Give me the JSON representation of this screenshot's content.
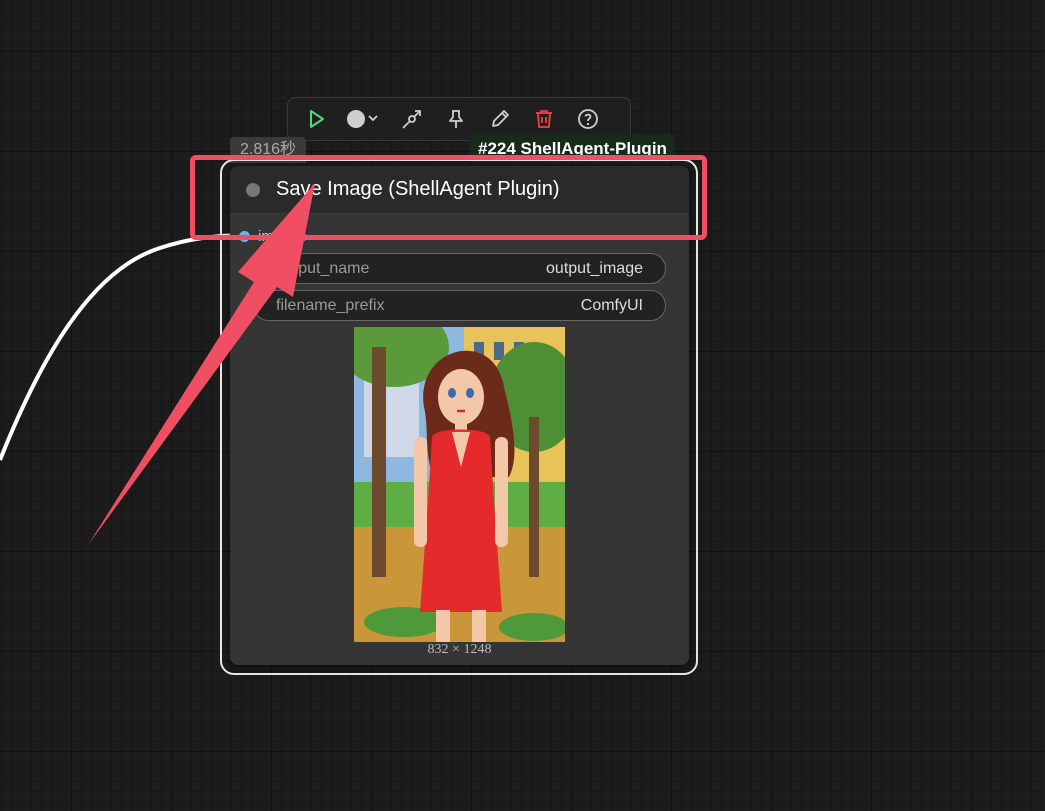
{
  "toolbar": {
    "buttons": [
      {
        "icon": "play-icon",
        "color": "#4ade80"
      },
      {
        "icon": "color-dot-dropdown-icon",
        "color": "#cfcfcf"
      },
      {
        "icon": "bypass-icon",
        "color": "#cfcfcf"
      },
      {
        "icon": "pin-icon",
        "color": "#cfcfcf"
      },
      {
        "icon": "pencil-icon",
        "color": "#cfcfcf"
      },
      {
        "icon": "trash-icon",
        "color": "#ef4444"
      },
      {
        "icon": "help-icon",
        "color": "#cfcfcf"
      }
    ]
  },
  "node": {
    "execution_time": "2.816秒",
    "id_badge": "#224 ShellAgent-Plugin",
    "title": "Save Image (ShellAgent Plugin)",
    "input": {
      "label": "images",
      "color": "#64b5f6"
    },
    "widgets": [
      {
        "label": "output_name",
        "value": "output_image"
      },
      {
        "label": "filename_prefix",
        "value": "ComfyUI"
      }
    ],
    "image_dimensions": "832 × 1248"
  },
  "annotation": {
    "color": "#f04e63"
  }
}
